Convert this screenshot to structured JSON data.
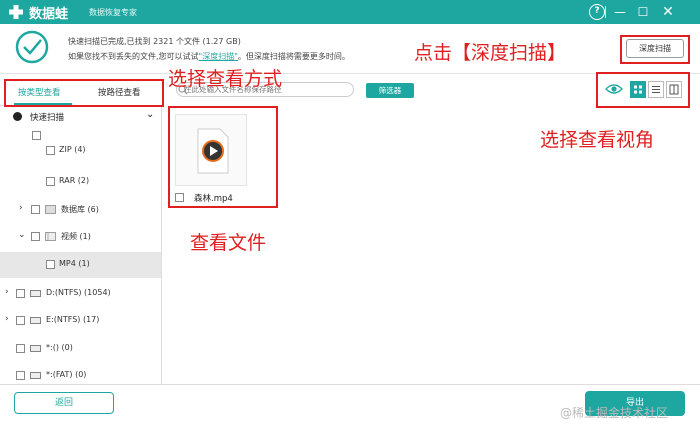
{
  "colors": {
    "accent": "#1ea7a0",
    "annotation": "#e02020"
  },
  "app": {
    "title": "数据蛙",
    "subtitle": "数据恢复专家",
    "logo_icon": "frog-plus-icon"
  },
  "window": {
    "help": "?",
    "minimize": "—",
    "maximize": "☐",
    "close": "✕"
  },
  "status": {
    "line1": "快速扫描已完成,已找到 2321 个文件 (1.27 GB)",
    "line2_before": "如果您找不到丢失的文件,您可以试试",
    "line2_link": "\"深度扫描\"",
    "line2_after": "。但深度扫描将需要更多时间。",
    "deep_scan_button": "深度扫描"
  },
  "tabs": [
    {
      "label": "按类型查看",
      "active": true
    },
    {
      "label": "按路径查看",
      "active": false
    }
  ],
  "search": {
    "placeholder": "在此处输入文件名称保存路径"
  },
  "filter_button": "筛选器",
  "sidebar": {
    "header": "快速扫描",
    "items": [
      {
        "label": "ZIP (4)"
      },
      {
        "label": "RAR (2)"
      },
      {
        "label": "数据库 (6)"
      },
      {
        "label": "视频 (1)"
      },
      {
        "label": "MP4 (1)"
      },
      {
        "label": "D:(NTFS) (1054)"
      },
      {
        "label": "E:(NTFS) (17)"
      },
      {
        "label": "*:() (0)"
      },
      {
        "label": "*:(FAT) (0)"
      }
    ]
  },
  "file": {
    "name": "森林.mp4"
  },
  "footer": {
    "back_button": "返回",
    "export_button": "导出",
    "watermark": "@稀土掘金技术社区"
  },
  "annotations": {
    "click_deep": "点击【深度扫描】",
    "choose_mode": "选择查看方式",
    "choose_view": "选择查看视角",
    "view_file": "查看文件"
  }
}
